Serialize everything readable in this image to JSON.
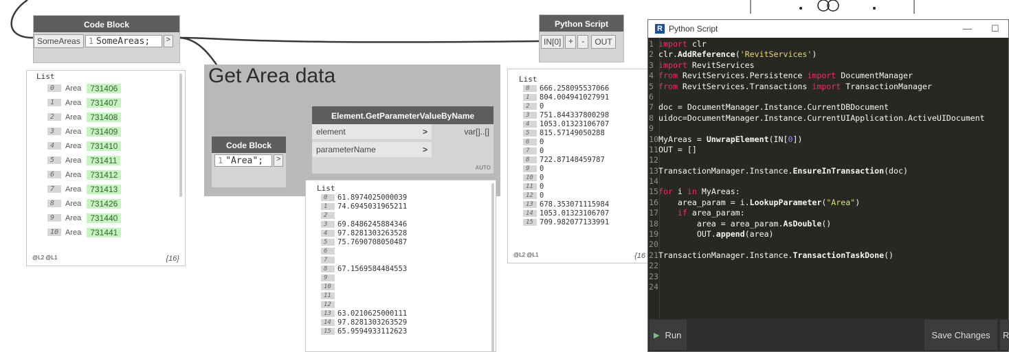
{
  "code_block_1": {
    "title": "Code Block",
    "input_port": "SomeAreas",
    "line_no": "1",
    "code": "SomeAreas;",
    "out": ">"
  },
  "watch_1": {
    "header": "List",
    "items": [
      {
        "i": "0",
        "label": "Area",
        "val": "731406"
      },
      {
        "i": "1",
        "label": "Area",
        "val": "731407"
      },
      {
        "i": "2",
        "label": "Area",
        "val": "731408"
      },
      {
        "i": "3",
        "label": "Area",
        "val": "731409"
      },
      {
        "i": "4",
        "label": "Area",
        "val": "731410"
      },
      {
        "i": "5",
        "label": "Area",
        "val": "731411"
      },
      {
        "i": "6",
        "label": "Area",
        "val": "731412"
      },
      {
        "i": "7",
        "label": "Area",
        "val": "731413"
      },
      {
        "i": "8",
        "label": "Area",
        "val": "731426"
      },
      {
        "i": "9",
        "label": "Area",
        "val": "731440"
      },
      {
        "i": "10",
        "label": "Area",
        "val": "731441"
      }
    ],
    "levels": "@L2 @L1",
    "count": "{16}"
  },
  "group": {
    "title": "Get Area data"
  },
  "code_block_2": {
    "title": "Code Block",
    "line_no": "1",
    "code": "\"Area\";",
    "out": ">"
  },
  "get_param": {
    "title": "Element.GetParameterValueByName",
    "in1": "element",
    "in2": "parameterName",
    "out": "var[]..[]",
    "lacing": "AUTO",
    "arrow": ">"
  },
  "watch_2": {
    "header": "List",
    "items": [
      {
        "i": "0",
        "val": "61.8974025000039"
      },
      {
        "i": "1",
        "val": "74.6945031965211"
      },
      {
        "i": "2",
        "val": ""
      },
      {
        "i": "3",
        "val": "69.8486245884346"
      },
      {
        "i": "4",
        "val": "97.8281303263528"
      },
      {
        "i": "5",
        "val": "75.7690708050487"
      },
      {
        "i": "6",
        "val": ""
      },
      {
        "i": "7",
        "val": ""
      },
      {
        "i": "8",
        "val": "67.1569584484553"
      },
      {
        "i": "9",
        "val": ""
      },
      {
        "i": "10",
        "val": ""
      },
      {
        "i": "11",
        "val": ""
      },
      {
        "i": "12",
        "val": ""
      },
      {
        "i": "13",
        "val": "63.0210625000111"
      },
      {
        "i": "14",
        "val": "97.8281303263529"
      },
      {
        "i": "15",
        "val": "65.9594933112623"
      }
    ]
  },
  "python_node": {
    "title": "Python Script",
    "in": "IN[0]",
    "plus": "+",
    "minus": "-",
    "out": "OUT"
  },
  "watch_3": {
    "header": "List",
    "items": [
      {
        "i": "0",
        "val": "666.258095537066"
      },
      {
        "i": "1",
        "val": "804.004941027991"
      },
      {
        "i": "2",
        "val": "0"
      },
      {
        "i": "3",
        "val": "751.844337800298"
      },
      {
        "i": "4",
        "val": "1053.01323106707"
      },
      {
        "i": "5",
        "val": "815.57149050288"
      },
      {
        "i": "6",
        "val": "0"
      },
      {
        "i": "7",
        "val": "0"
      },
      {
        "i": "8",
        "val": "722.87148459787"
      },
      {
        "i": "9",
        "val": "0"
      },
      {
        "i": "10",
        "val": "0"
      },
      {
        "i": "11",
        "val": "0"
      },
      {
        "i": "12",
        "val": "0"
      },
      {
        "i": "13",
        "val": "678.353071115984"
      },
      {
        "i": "14",
        "val": "1053.01323106707"
      },
      {
        "i": "15",
        "val": "709.982077133991"
      }
    ],
    "levels": "@L2 @L1",
    "count": "{16"
  },
  "editor": {
    "title": "Python Script",
    "min": "—",
    "max": "☐",
    "run": "Run",
    "save": "Save Changes",
    "revert": "R",
    "lines": [
      [
        {
          "t": "import",
          "c": "kw"
        },
        {
          "t": " clr"
        }
      ],
      [
        {
          "t": "clr."
        },
        {
          "t": "AddReference",
          "c": "fn"
        },
        {
          "t": "("
        },
        {
          "t": "'RevitServices'",
          "c": "str"
        },
        {
          "t": ")"
        }
      ],
      [
        {
          "t": "import",
          "c": "kw"
        },
        {
          "t": " RevitServices"
        }
      ],
      [
        {
          "t": "from",
          "c": "kw"
        },
        {
          "t": " RevitServices.Persistence "
        },
        {
          "t": "import",
          "c": "kw"
        },
        {
          "t": " DocumentManager"
        }
      ],
      [
        {
          "t": "from",
          "c": "kw"
        },
        {
          "t": " RevitServices.Transactions "
        },
        {
          "t": "import",
          "c": "kw"
        },
        {
          "t": " TransactionManager"
        }
      ],
      [],
      [
        {
          "t": "doc = DocumentManager.Instance.CurrentDBDocument"
        }
      ],
      [
        {
          "t": "uidoc=DocumentManager.Instance.CurrentUIApplication.ActiveUIDocument"
        }
      ],
      [],
      [
        {
          "t": "MyAreas = "
        },
        {
          "t": "UnwrapElement",
          "c": "fn"
        },
        {
          "t": "(IN["
        },
        {
          "t": "0",
          "c": "num"
        },
        {
          "t": "])"
        }
      ],
      [
        {
          "t": "OUT = []"
        }
      ],
      [],
      [
        {
          "t": "TransactionManager.Instance."
        },
        {
          "t": "EnsureInTransaction",
          "c": "fn"
        },
        {
          "t": "(doc)"
        }
      ],
      [],
      [
        {
          "t": "for",
          "c": "kw"
        },
        {
          "t": " i "
        },
        {
          "t": "in",
          "c": "kw"
        },
        {
          "t": " MyAreas:"
        }
      ],
      [
        {
          "t": "    area_param = i."
        },
        {
          "t": "LookupParameter",
          "c": "fn"
        },
        {
          "t": "("
        },
        {
          "t": "\"Area\"",
          "c": "str"
        },
        {
          "t": ")"
        }
      ],
      [
        {
          "t": "    "
        },
        {
          "t": "if",
          "c": "kw"
        },
        {
          "t": " area_param:"
        }
      ],
      [
        {
          "t": "        area = area_param."
        },
        {
          "t": "AsDouble",
          "c": "fn"
        },
        {
          "t": "()"
        }
      ],
      [
        {
          "t": "        OUT."
        },
        {
          "t": "append",
          "c": "fn"
        },
        {
          "t": "(area)"
        }
      ],
      [],
      [
        {
          "t": "TransactionManager.Instance."
        },
        {
          "t": "TransactionTaskDone",
          "c": "fn"
        },
        {
          "t": "()"
        }
      ],
      [],
      [],
      []
    ]
  }
}
